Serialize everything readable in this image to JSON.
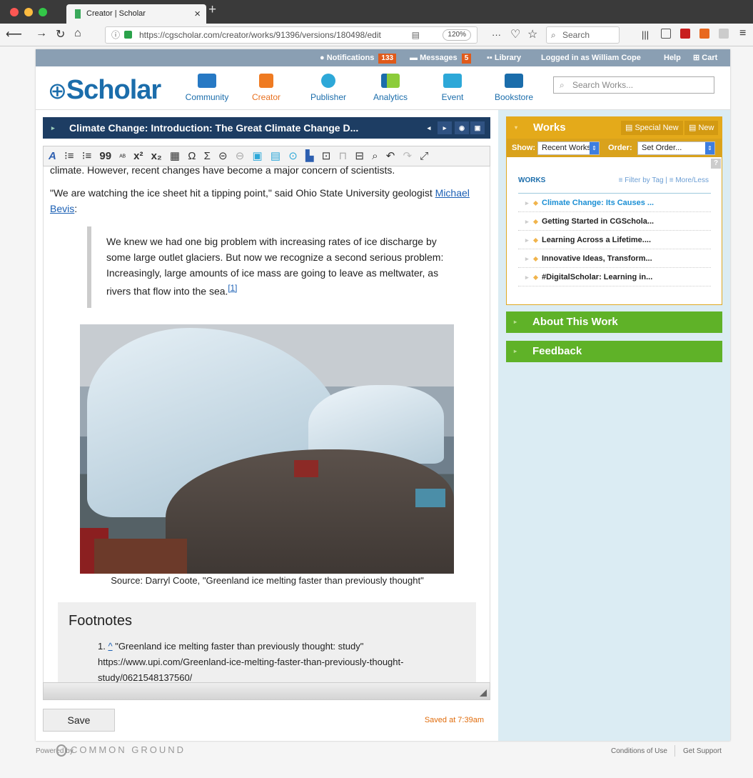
{
  "browser": {
    "tab_title": "Creator | Scholar",
    "tab_close": "×",
    "new_tab": "+",
    "url": "https://cgscholar.com/creator/works/91396/versions/180498/edit",
    "zoom": "120%",
    "url_more": "···",
    "search_placeholder": "Search"
  },
  "topbar": {
    "notifications_label": "Notifications",
    "notifications_count": "133",
    "messages_label": "Messages",
    "messages_count": "5",
    "library_label": "Library",
    "logged_in": "Logged in as William Cope",
    "help": "Help",
    "cart": "Cart"
  },
  "header": {
    "logo": "Scholar",
    "nav": [
      "Community",
      "Creator",
      "Publisher",
      "Analytics",
      "Event",
      "Bookstore"
    ],
    "search_placeholder": "Search Works..."
  },
  "editor": {
    "title": "Climate Change: Introduction: The Great Climate Change D...",
    "toolbar_glyphs": [
      "A",
      "⁝≡",
      "⁝≡",
      "99",
      "ᴬᴮ",
      "x²",
      "x₂",
      "▦",
      "Ω",
      "Σ",
      "⊝",
      "⊖",
      "▣",
      "▤",
      "⊙",
      "▙",
      "⊡",
      "⊓",
      "⊟",
      "⌕",
      "↶",
      "↷",
      "⤢"
    ],
    "para1": "climate. However, recent changes have become a major concern of scientists.",
    "para2_before": "\"We are watching the ice sheet hit a tipping point,\" said Ohio State University geologist ",
    "para2_link": "Michael Bevis",
    "para2_after": ":",
    "quote": "We knew we had one big problem with increasing rates of ice discharge by some large outlet glaciers. But now we recognize a second serious problem: Increasingly, large amounts of ice mass are going to leave as meltwater, as rivers that flow into the sea.",
    "quote_ref": "[1]",
    "caption": "Source: Darryl Coote, \"Greenland ice melting faster than previously thought\"",
    "footnotes_title": "Footnotes",
    "footnote_num": "1.",
    "footnote_caret": "^",
    "footnote_text": "\"Greenland ice melting faster than previously thought: study\" https://www.upi.com/Greenland-ice-melting-faster-than-previously-thought-study/0621548137560/",
    "save_label": "Save",
    "saved_status": "Saved at 7:39am"
  },
  "works": {
    "title": "Works",
    "special_new": "Special New",
    "new": "New",
    "show_label": "Show:",
    "show_value": "Recent Works",
    "order_label": "Order:",
    "order_value": "Set Order...",
    "help_mark": "?",
    "list_label": "WORKS",
    "filter": "Filter by Tag",
    "more_less": "More/Less",
    "items": [
      "Climate Change: Its Causes ...",
      "Getting Started in CGSchola...",
      "Learning Across a Lifetime....",
      "Innovative Ideas, Transform...",
      "#DigitalScholar: Learning in..."
    ]
  },
  "panels": {
    "about": "About This Work",
    "feedback": "Feedback"
  },
  "footer": {
    "powered_by": "Powered by",
    "brand": "COMMON GROUND",
    "conditions": "Conditions of Use",
    "support": "Get Support"
  }
}
